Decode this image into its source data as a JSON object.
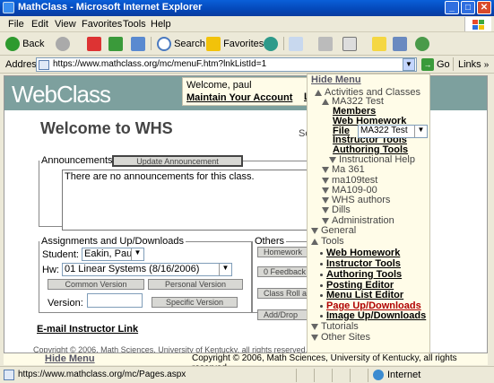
{
  "window": {
    "title": "MathClass - Microsoft Internet Explorer",
    "controls": [
      "_",
      "□",
      "✕"
    ]
  },
  "menubar": {
    "items": [
      "File",
      "Edit",
      "View",
      "Favorites",
      "Tools",
      "Help"
    ]
  },
  "toolbar": {
    "back": "Back",
    "search": "Search",
    "favorites": "Favorites"
  },
  "addressbar": {
    "label": "Address",
    "url": "https://www.mathclass.org/mc/menuF.htm?lnkListId=1",
    "go": "Go",
    "links": "Links",
    "go_arrow": "→",
    "links_arrow": "»"
  },
  "header": {
    "logo": "WebClass",
    "welcome": "Welcome, paul",
    "maintain": "Maintain Your Account",
    "partial_link": "L"
  },
  "page": {
    "title": "Welcome to WHS",
    "side_text": "Se"
  },
  "announcements": {
    "legend": "Announcements",
    "update_button": "Update Announcement",
    "text": "There are no announcements for this class."
  },
  "assignments": {
    "legend": "Assignments and Up/Downloads",
    "student_label": "Student:",
    "student_value": "Eakin, Paul",
    "hw_label": "Hw:",
    "hw_value": "01 Linear Systems (8/16/2006)",
    "common_version": "Common Version",
    "personal_version": "Personal Version",
    "version_label": "Version:",
    "version_value": "",
    "specific_version": "Specific Version"
  },
  "others": {
    "legend": "Others",
    "buttons": [
      "Homework",
      "0 Feedback",
      "Class Roll a",
      "Add/Drop"
    ]
  },
  "email_link": "E-mail Instructor Link",
  "copyright_inner": "Copyright © 2006, Math Sciences, University of Kentucky, all rights reserved.",
  "floatmenu": {
    "hide": "Hide Menu",
    "select_value": "MA322 Test",
    "items": [
      {
        "text": "Activities and Classes",
        "kind": "up"
      },
      {
        "text": "MA322 Test",
        "kind": "up"
      },
      {
        "text": "Members",
        "kind": "link"
      },
      {
        "text": "Web Homework",
        "kind": "link"
      },
      {
        "text": "File",
        "kind": "link"
      },
      {
        "text": "Instructor Tools",
        "kind": "link"
      },
      {
        "text": "Authoring Tools",
        "kind": "link"
      },
      {
        "text": "Instructional  Help",
        "kind": "down"
      },
      {
        "text": "Ma 361",
        "kind": "down"
      },
      {
        "text": "ma109test",
        "kind": "down"
      },
      {
        "text": "MA109-00",
        "kind": "down"
      },
      {
        "text": "WHS authors",
        "kind": "down"
      },
      {
        "text": "Dills",
        "kind": "down"
      },
      {
        "text": "Administration",
        "kind": "down"
      },
      {
        "text": "General",
        "kind": "down"
      },
      {
        "text": "Tools",
        "kind": "up"
      },
      {
        "text": "Web Homework",
        "kind": "dotlink"
      },
      {
        "text": "Instructor Tools",
        "kind": "dotlink"
      },
      {
        "text": "Authoring Tools",
        "kind": "dotlink"
      },
      {
        "text": "Posting Editor",
        "kind": "dotlink"
      },
      {
        "text": "Menu List Editor",
        "kind": "dotlink"
      },
      {
        "text": "Page Up/Downloads",
        "kind": "dothl"
      },
      {
        "text": "Image Up/Downloads",
        "kind": "dotlink"
      },
      {
        "text": "Tutorials",
        "kind": "down"
      },
      {
        "text": "Other Sites",
        "kind": "down"
      }
    ]
  },
  "bottom": {
    "hide": "Hide Menu",
    "copyright": "Copyright © 2006, Math Sciences, University of Kentucky, all rights reserved."
  },
  "statusbar": {
    "url": "https://www.mathclass.org/mc/Pages.aspx",
    "zone": "Internet"
  }
}
